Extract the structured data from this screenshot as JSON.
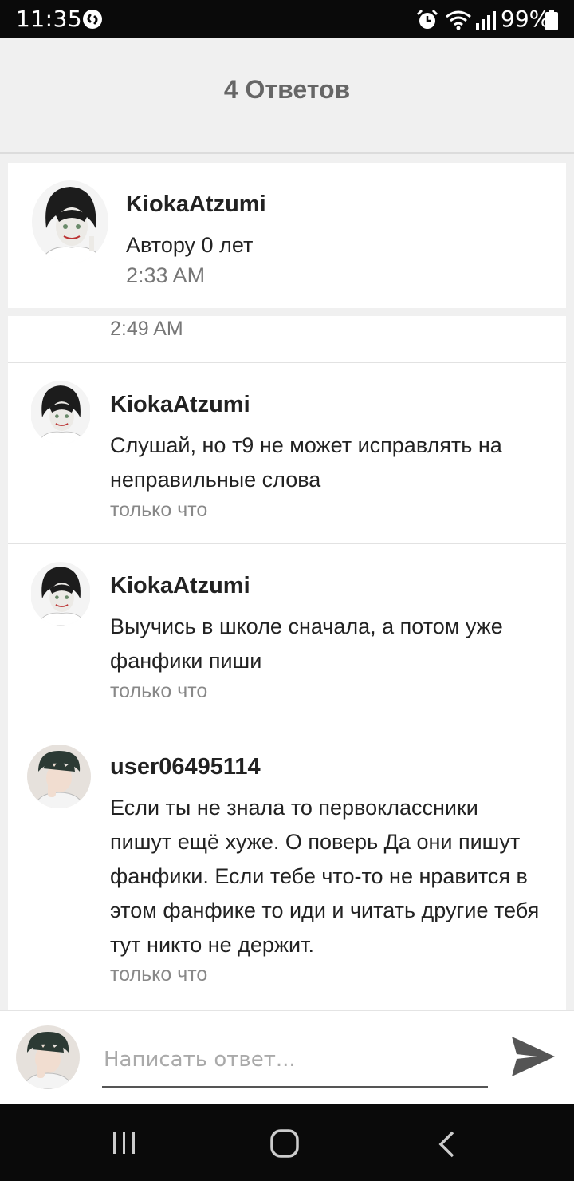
{
  "status_bar": {
    "time": "11:35",
    "battery": "99%",
    "icons": [
      "shazam-icon",
      "alarm-icon",
      "wifi-icon",
      "signal-icon",
      "battery-icon"
    ]
  },
  "header": {
    "title": "4 Ответов"
  },
  "author_card": {
    "name": "KiokaAtzumi",
    "text": "Автору 0 лет",
    "time": "2:33 AM"
  },
  "previous_reply_time": "2:49 AM",
  "replies": [
    {
      "name": "KiokaAtzumi",
      "text": "Слушай, но т9 не может исправлять на неправильные слова",
      "time": "только что"
    },
    {
      "name": "KiokaAtzumi",
      "text": "Выучись в школе сначала, а потом уже фанфики пиши",
      "time": "только что"
    },
    {
      "name": "user06495114",
      "text": "Если ты не знала то первоклассники пишут ещё хуже. О поверь Да они пишут фанфики. Если тебе что-то не нравится в этом фанфике то иди и читать другие тебя тут никто не держит.",
      "time": "только что"
    }
  ],
  "composer": {
    "placeholder": "Написать ответ..."
  },
  "colors": {
    "header_bg": "#f0f0f0",
    "title": "#666666",
    "secondary_text": "#888888",
    "bars": "#0a0a0a"
  }
}
